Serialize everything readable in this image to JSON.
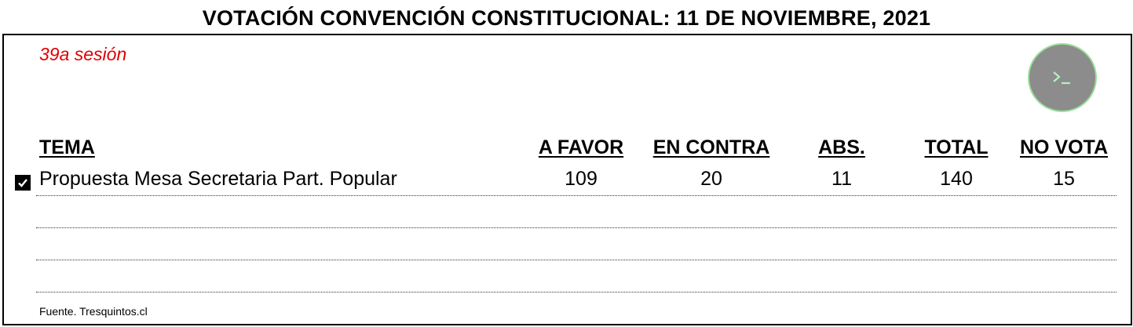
{
  "title": "VOTACIÓN CONVENCIÓN CONSTITUCIONAL: 11 DE NOVIEMBRE, 2021",
  "session": "39a sesión",
  "terminal_icon": "terminal-icon",
  "table": {
    "headers": {
      "tema": "TEMA",
      "a_favor": "A FAVOR",
      "en_contra": "EN CONTRA",
      "abs": "ABS.",
      "total": "TOTAL",
      "no_vota": "NO VOTA"
    },
    "rows": [
      {
        "checked": true,
        "tema": "Propuesta Mesa Secretaria Part. Popular",
        "a_favor": "109",
        "en_contra": "20",
        "abs": "11",
        "total": "140",
        "no_vota": "15"
      }
    ]
  },
  "source": "Fuente. Tresquintos.cl",
  "colors": {
    "session_text": "#e00000",
    "terminal_button_fill": "#8c8c8c",
    "terminal_button_accent": "#9be09b"
  }
}
